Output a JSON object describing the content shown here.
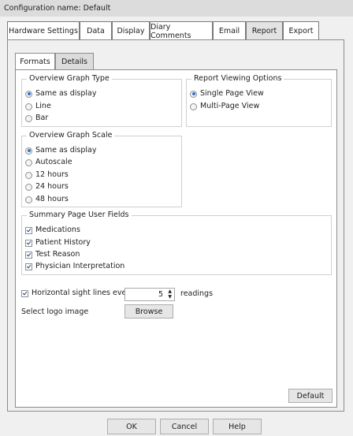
{
  "config": {
    "label": "Configuration name: Default"
  },
  "tabs": [
    {
      "label": "Hardware Settings"
    },
    {
      "label": "Data"
    },
    {
      "label": "Display"
    },
    {
      "label": "Diary Comments"
    },
    {
      "label": "Email"
    },
    {
      "label": "Report",
      "active": true
    },
    {
      "label": "Export"
    }
  ],
  "subtabs": [
    {
      "label": "Formats"
    },
    {
      "label": "Details",
      "active": true
    }
  ],
  "overview_type": {
    "title": "Overview Graph Type",
    "options": [
      "Same as display",
      "Line",
      "Bar"
    ],
    "selected": "Same as display"
  },
  "report_viewing": {
    "title": "Report  Viewing Options",
    "options": [
      "Single Page View",
      "Multi-Page View"
    ],
    "selected": "Single Page View"
  },
  "overview_scale": {
    "title": "Overview Graph Scale",
    "options": [
      "Same as display",
      "Autoscale",
      "12 hours",
      "24 hours",
      "48 hours"
    ],
    "selected": "Same as display"
  },
  "summary_fields": {
    "title": "Summary Page User Fields",
    "items": [
      {
        "label": "Medications",
        "checked": true
      },
      {
        "label": "Patient History",
        "checked": true
      },
      {
        "label": "Test Reason",
        "checked": true
      },
      {
        "label": "Physician Interpretation",
        "checked": true
      }
    ]
  },
  "sight_lines": {
    "label": "Horizontal sight lines every",
    "checked": true,
    "value": "5",
    "suffix": "readings"
  },
  "logo": {
    "label": "Select logo image",
    "browse": "Browse"
  },
  "buttons": {
    "default": "Default",
    "ok": "OK",
    "cancel": "Cancel",
    "help": "Help"
  },
  "colors": {
    "accent": "#2b73d0",
    "check": "#1c3f94"
  }
}
